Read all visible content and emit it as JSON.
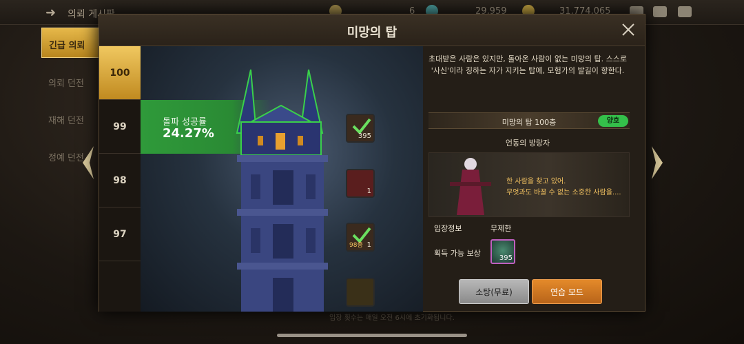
{
  "topbar": {
    "title": "의뢰 게시판",
    "resource1": "6",
    "resource2": "29,959",
    "resource3": "31,774,065"
  },
  "side_menu": {
    "items": [
      {
        "label": "긴급 의뢰"
      },
      {
        "label": "의뢰 던전"
      },
      {
        "label": "재해 던전"
      },
      {
        "label": "정예 던전"
      }
    ]
  },
  "modal": {
    "title": "미망의 탑"
  },
  "floors": [
    {
      "label": "100"
    },
    {
      "label": "99"
    },
    {
      "label": "98"
    },
    {
      "label": "97"
    }
  ],
  "tower": {
    "success_label": "돌파 성공률",
    "success_value": "24.27%",
    "rewards": [
      {
        "count": "395",
        "floor_label": ""
      },
      {
        "count": "1",
        "floor_label": ""
      },
      {
        "count": "1",
        "floor_label": "98층"
      },
      {
        "count": "",
        "floor_label": ""
      }
    ]
  },
  "detail": {
    "description": "초대받은 사람은 있지만, 돌아온 사람이 없는 미망의 탑. 스스로 '사신'이라 칭하는 자가 지키는 탑에, 모험가의 발길이 향한다.",
    "floor_title": "미망의 탑 100층",
    "status_badge": "양호",
    "boss_name": "언동의 방랑자",
    "boss_quote_line1": "한 사람을 찾고 있어.",
    "boss_quote_line2": "무엇과도 바꿀 수 없는 소중한 사람을....",
    "entry_label": "입장정보",
    "entry_value": "무제한",
    "reward_label": "획득 가능 보상",
    "reward_count": "395",
    "sweep_button": "소탕(무료)",
    "practice_button": "연습 모드"
  },
  "footer": {
    "note": "입장 횟수는 매일 오전 6시에 초기화됩니다."
  },
  "colors": {
    "accent_gold": "#e6b84a",
    "success_green": "#2f9a3a",
    "orange_button": "#d0781f",
    "badge_green": "#34c04a"
  }
}
